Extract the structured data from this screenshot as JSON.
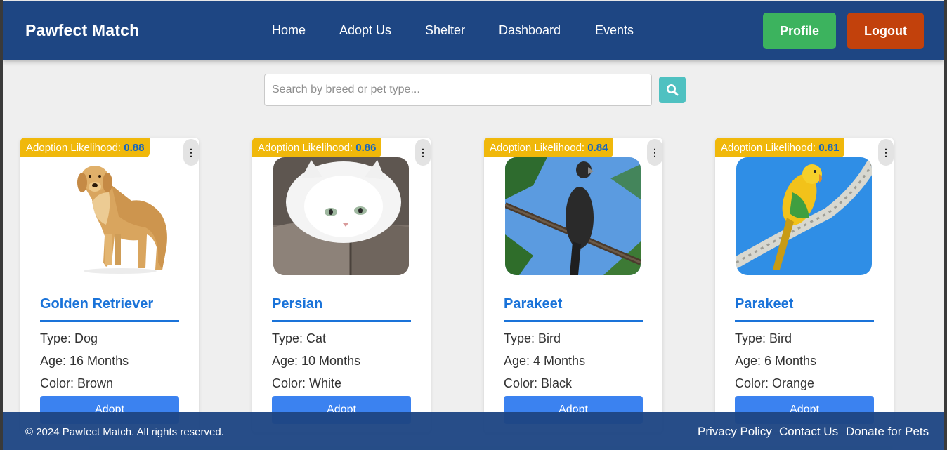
{
  "nav": {
    "brand": "Pawfect Match",
    "links": [
      "Home",
      "Adopt Us",
      "Shelter",
      "Dashboard",
      "Events"
    ],
    "profile_label": "Profile",
    "logout_label": "Logout"
  },
  "search": {
    "placeholder": "Search by breed or pet type...",
    "value": ""
  },
  "pets": [
    {
      "likelihood_label": "Adoption Likelihood:",
      "likelihood": "0.88",
      "name": "Golden Retriever",
      "type": "Type: Dog",
      "age": "Age: 16 Months",
      "color": "Color: Brown",
      "adopt_label": "Adopt",
      "menu": "⋮"
    },
    {
      "likelihood_label": "Adoption Likelihood:",
      "likelihood": "0.86",
      "name": "Persian",
      "type": "Type: Cat",
      "age": "Age: 10 Months",
      "color": "Color: White",
      "adopt_label": "Adopt",
      "menu": "⋮"
    },
    {
      "likelihood_label": "Adoption Likelihood:",
      "likelihood": "0.84",
      "name": "Parakeet",
      "type": "Type: Bird",
      "age": "Age: 4 Months",
      "color": "Color: Black",
      "adopt_label": "Adopt",
      "menu": "⋮"
    },
    {
      "likelihood_label": "Adoption Likelihood:",
      "likelihood": "0.81",
      "name": "Parakeet",
      "type": "Type: Bird",
      "age": "Age: 6 Months",
      "color": "Color: Orange",
      "adopt_label": "Adopt",
      "menu": "⋮"
    }
  ],
  "footer": {
    "copyright": "© 2024 Pawfect Match. All rights reserved.",
    "links": [
      "Privacy Policy",
      "Contact Us",
      "Donate for Pets"
    ]
  },
  "colors": {
    "navbar": "#1e4683",
    "profile": "#3cb35e",
    "logout": "#c2410c",
    "badge": "#f0b80b",
    "accent": "#1a73d9",
    "adopt": "#3b82f0"
  }
}
